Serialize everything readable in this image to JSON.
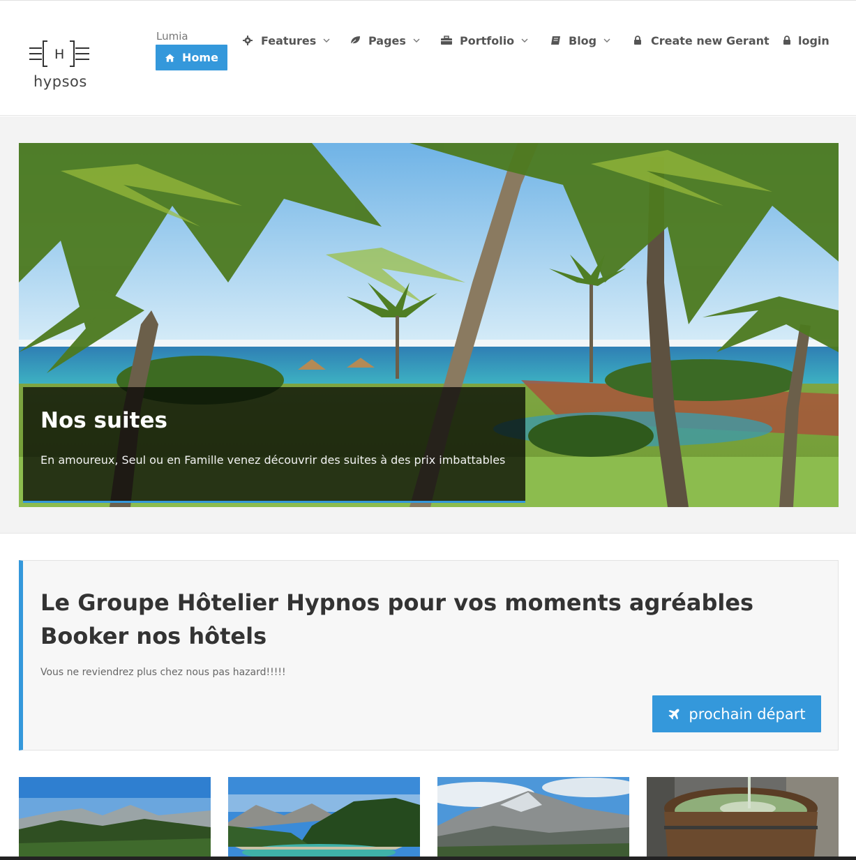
{
  "header": {
    "logo_text": "hypsos",
    "logo_letter": "H",
    "brand_small": "Lumia",
    "home_label": "Home",
    "nav": [
      {
        "label": "Features",
        "icon": "gear-icon",
        "dropdown": true
      },
      {
        "label": "Pages",
        "icon": "leaf-icon",
        "dropdown": true
      },
      {
        "label": "Portfolio",
        "icon": "briefcase-icon",
        "dropdown": true
      },
      {
        "label": "Blog",
        "icon": "book-icon",
        "dropdown": true
      },
      {
        "label": "Create new Gerant",
        "icon": "lock-icon",
        "dropdown": false
      },
      {
        "label": "login",
        "icon": "lock-icon",
        "dropdown": false
      }
    ]
  },
  "slider": {
    "title": "Nos suites",
    "text": "En amoureux, Seul ou en Famille venez découvrir des suites à des prix imbattables"
  },
  "cta": {
    "title": "Le Groupe Hôtelier Hypnos pour vos moments agréables Booker nos hôtels",
    "subtitle": "Vous ne reviendrez plus chez nous pas hazard!!!!!",
    "button_label": "prochain départ",
    "button_icon": "plane-icon"
  },
  "colors": {
    "accent": "#3498db",
    "text_dark": "#333333",
    "nav_text": "#555555"
  }
}
